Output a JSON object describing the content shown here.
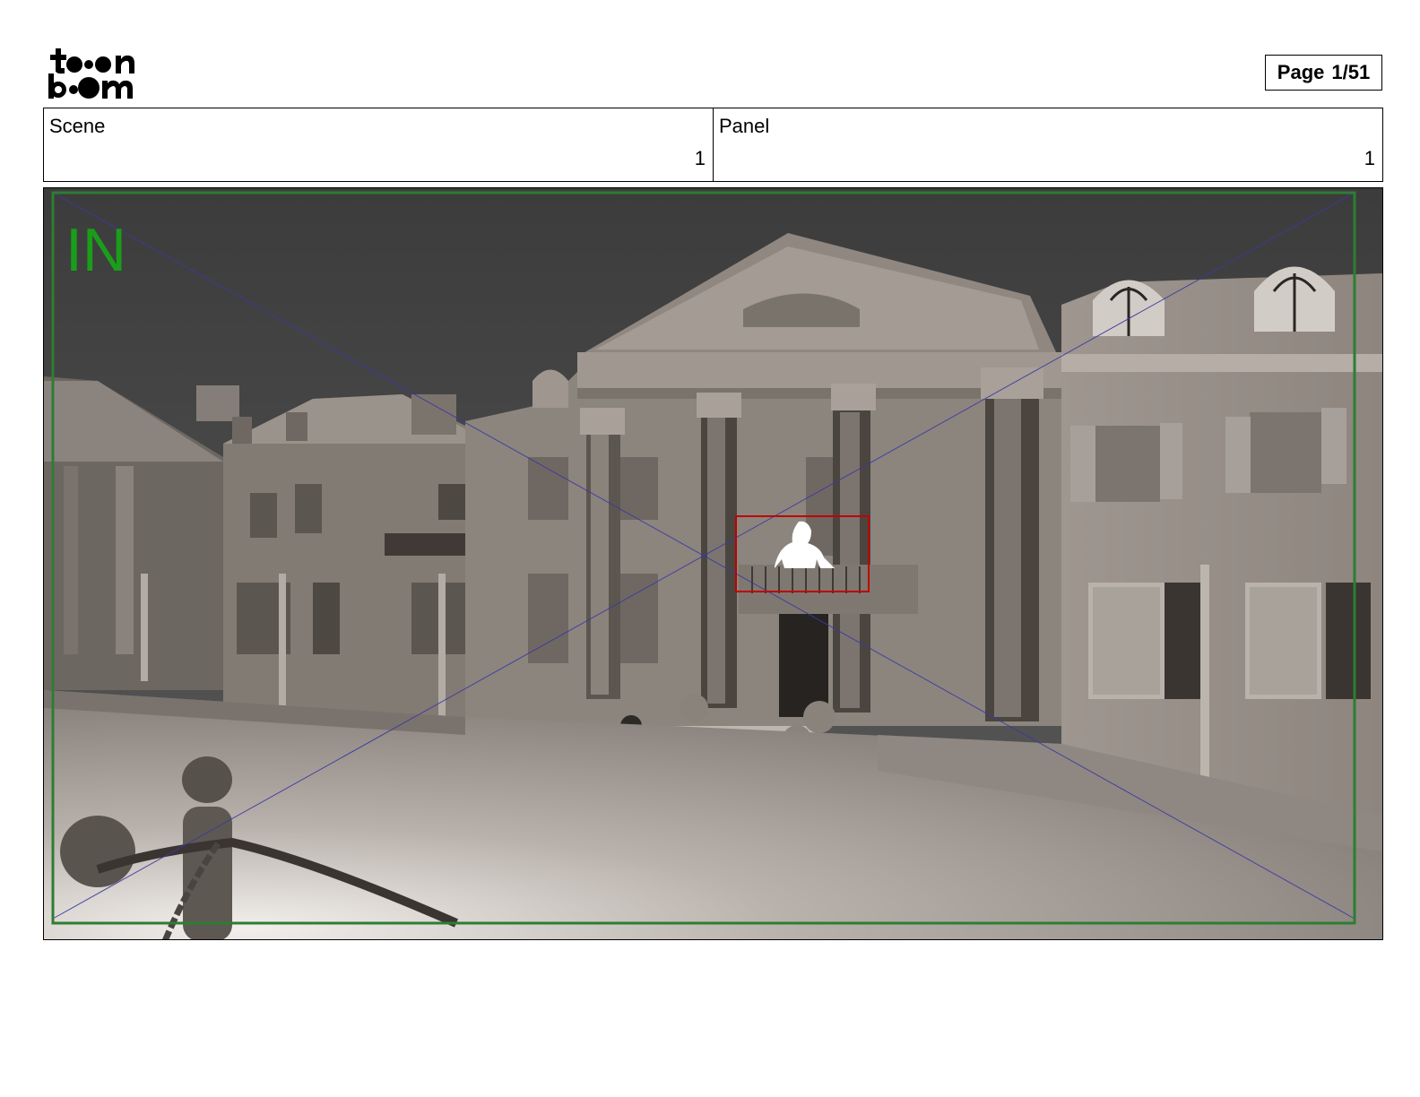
{
  "logo": {
    "line1": "to•n",
    "line2": "b•om",
    "icon": "toon-boom-logo"
  },
  "page": {
    "label": "Page",
    "value": "1/51"
  },
  "info": {
    "scene_label": "Scene",
    "scene_value": "1",
    "panel_label": "Panel",
    "panel_value": "1"
  },
  "panel_image": {
    "transition_tag": "IN",
    "colors": {
      "safe_frame": "#2e7d32",
      "camera_guides": "#3a3aa0",
      "character_box": "#c00000",
      "in_tag": "#1a9e1a"
    }
  }
}
